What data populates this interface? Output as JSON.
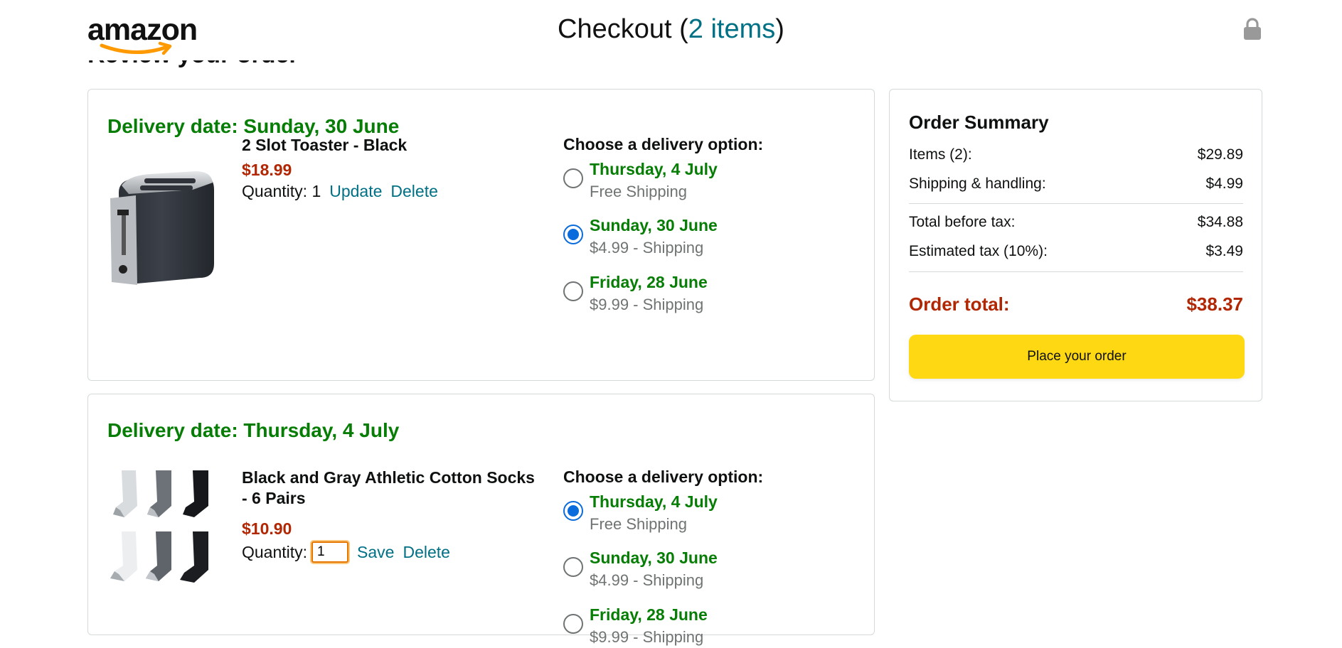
{
  "header": {
    "logo_text": "amazon",
    "title_prefix": "Checkout (",
    "title_count": "2 items",
    "title_suffix": ")",
    "partial_section_title": "Review your order"
  },
  "shipments": [
    {
      "delivery_date": "Delivery date: Sunday, 30 June",
      "product_name": "2 Slot Toaster - Black",
      "price": "$18.99",
      "quantity_label": "Quantity:",
      "quantity_value": "1",
      "update_label": "Update",
      "delete_label": "Delete",
      "options_title": "Choose a delivery option:",
      "options": [
        {
          "date": "Thursday, 4 July",
          "shipping": "Free Shipping",
          "selected": false
        },
        {
          "date": "Sunday, 30 June",
          "shipping": "$4.99 - Shipping",
          "selected": true
        },
        {
          "date": "Friday, 28 June",
          "shipping": "$9.99 - Shipping",
          "selected": false
        }
      ]
    },
    {
      "delivery_date": "Delivery date: Thursday, 4 July",
      "product_name": "Black and Gray Athletic Cotton Socks - 6 Pairs",
      "price": "$10.90",
      "quantity_label": "Quantity:",
      "quantity_value": "1",
      "save_label": "Save",
      "delete_label": "Delete",
      "options_title": "Choose a delivery option:",
      "options": [
        {
          "date": "Thursday, 4 July",
          "shipping": "Free Shipping",
          "selected": true
        },
        {
          "date": "Sunday, 30 June",
          "shipping": "$4.99 - Shipping",
          "selected": false
        },
        {
          "date": "Friday, 28 June",
          "shipping": "$9.99 - Shipping",
          "selected": false
        }
      ]
    }
  ],
  "summary": {
    "title": "Order Summary",
    "items_label": "Items (2):",
    "items_value": "$29.89",
    "shipping_label": "Shipping & handling:",
    "shipping_value": "$4.99",
    "before_tax_label": "Total before tax:",
    "before_tax_value": "$34.88",
    "tax_label": "Estimated tax (10%):",
    "tax_value": "$3.49",
    "total_label": "Order total:",
    "total_value": "$38.37",
    "place_order_label": "Place your order"
  },
  "colors": {
    "delivery_green": "#067d04",
    "price_red": "#b12704",
    "link_teal": "#007185",
    "button_yellow": "#ffd814",
    "radio_blue": "#0a6cdc",
    "logo_smile_orange": "#ff9900"
  },
  "icons": [
    "amazon-smile-logo",
    "lock-icon",
    "toaster-image",
    "socks-image"
  ]
}
